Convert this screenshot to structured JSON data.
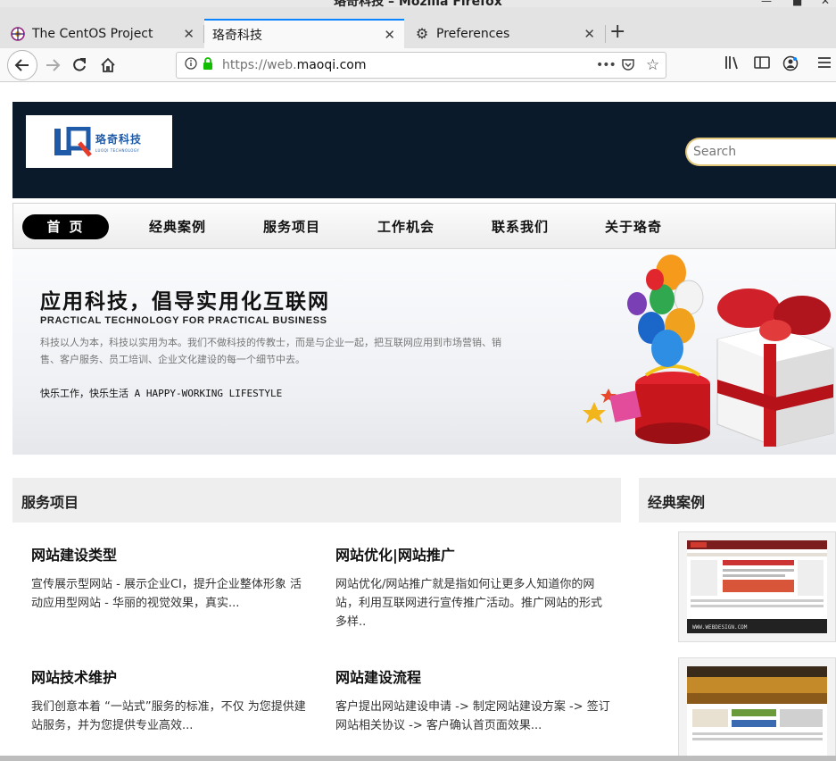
{
  "window": {
    "title": "珞奇科技 – Mozilla Firefox"
  },
  "tabs": [
    {
      "label": "The CentOS Project",
      "icon": "centos-icon"
    },
    {
      "label": "珞奇科技",
      "icon": "none"
    },
    {
      "label": "Preferences",
      "icon": "gear-icon"
    }
  ],
  "urlbar": {
    "prefix": "https://web.",
    "domain": "maoqi.com",
    "more": "•••"
  },
  "site": {
    "logo_cn": "珞奇科技",
    "logo_en": "LUOQI TECHNOLOGY",
    "search_placeholder": "Search",
    "nav": [
      "首页",
      "经典案例",
      "服务项目",
      "工作机会",
      "联系我们",
      "关于珞奇"
    ],
    "banner": {
      "title": "应用科技，倡导实用化互联网",
      "subtitle": "PRACTICAL TECHNOLOGY FOR PRACTICAL BUSINESS",
      "desc": "科技以人为本，科技以实用为本。我们不做科技的传教士，而是与企业一起，把互联网应用到市场营销、销售、客户服务、员工培训、企业文化建设的每一个细节中去。",
      "slogan": "快乐工作，快乐生活 A HAPPY-WORKING LIFESTYLE"
    },
    "services_heading": "服务项目",
    "cases_heading": "经典案例",
    "services": [
      {
        "title": "网站建设类型",
        "desc": "宣传展示型网站 - 展示企业CI，提升企业整体形象 活动应用型网站 - 华丽的视觉效果，真实..."
      },
      {
        "title": "网站优化|网站推广",
        "desc": "网站优化/网站推广就是指如何让更多人知道你的网站，利用互联网进行宣传推广活动。推广网站的形式多样.."
      },
      {
        "title": "网站技术维护",
        "desc": "我们创意本着 “一站式”服务的标准，不仅 为您提供建站服务，并为您提供专业高效..."
      },
      {
        "title": "网站建设流程",
        "desc": "客户提出网站建设申请 -> 制定网站建设方案 -> 签订网站相关协议 -> 客户确认首页面效果..."
      }
    ],
    "case_thumb_caption": "WWW.WEBDESIGN.COM"
  },
  "colors": {
    "header_bg": "#0b1a2b",
    "accent": "#0a84ff",
    "nav_active": "#000000"
  }
}
